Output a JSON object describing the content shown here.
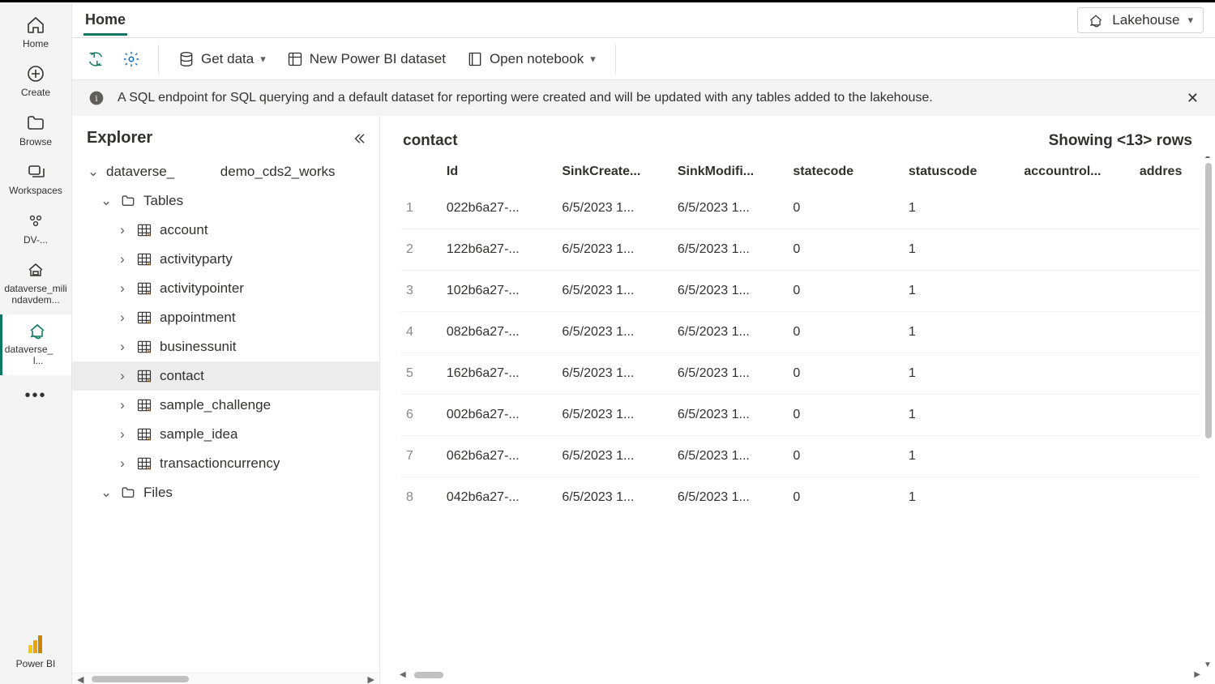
{
  "nav": {
    "items": [
      {
        "label": "Home"
      },
      {
        "label": "Create"
      },
      {
        "label": "Browse"
      },
      {
        "label": "Workspaces"
      },
      {
        "label": "DV-..."
      },
      {
        "label": "dataverse_milindavdem..."
      },
      {
        "label": "dataverse_       l..."
      }
    ],
    "powerbi_label": "Power BI"
  },
  "header": {
    "tab": "Home",
    "mode_selector": "Lakehouse"
  },
  "toolbar": {
    "get_data": "Get data",
    "new_dataset": "New Power BI dataset",
    "open_notebook": "Open notebook"
  },
  "infobar": {
    "message": "A SQL endpoint for SQL querying and a default dataset for reporting were created and will be updated with any tables added to the lakehouse."
  },
  "explorer": {
    "title": "Explorer",
    "root": "dataverse_            demo_cds2_works",
    "tables_label": "Tables",
    "files_label": "Files",
    "tables": [
      "account",
      "activityparty",
      "activitypointer",
      "appointment",
      "businessunit",
      "contact",
      "sample_challenge",
      "sample_idea",
      "transactioncurrency"
    ],
    "selected_table": "contact"
  },
  "grid": {
    "title": "contact",
    "row_count_text": "Showing <13> rows",
    "columns": [
      "Id",
      "SinkCreate...",
      "SinkModifi...",
      "statecode",
      "statuscode",
      "accountrol...",
      "addres"
    ],
    "rows": [
      {
        "n": "1",
        "Id": "022b6a27-...",
        "SinkCreate": "6/5/2023 1...",
        "SinkModifi": "6/5/2023 1...",
        "statecode": "0",
        "statuscode": "1"
      },
      {
        "n": "2",
        "Id": "122b6a27-...",
        "SinkCreate": "6/5/2023 1...",
        "SinkModifi": "6/5/2023 1...",
        "statecode": "0",
        "statuscode": "1"
      },
      {
        "n": "3",
        "Id": "102b6a27-...",
        "SinkCreate": "6/5/2023 1...",
        "SinkModifi": "6/5/2023 1...",
        "statecode": "0",
        "statuscode": "1"
      },
      {
        "n": "4",
        "Id": "082b6a27-...",
        "SinkCreate": "6/5/2023 1...",
        "SinkModifi": "6/5/2023 1...",
        "statecode": "0",
        "statuscode": "1"
      },
      {
        "n": "5",
        "Id": "162b6a27-...",
        "SinkCreate": "6/5/2023 1...",
        "SinkModifi": "6/5/2023 1...",
        "statecode": "0",
        "statuscode": "1"
      },
      {
        "n": "6",
        "Id": "002b6a27-...",
        "SinkCreate": "6/5/2023 1...",
        "SinkModifi": "6/5/2023 1...",
        "statecode": "0",
        "statuscode": "1"
      },
      {
        "n": "7",
        "Id": "062b6a27-...",
        "SinkCreate": "6/5/2023 1...",
        "SinkModifi": "6/5/2023 1...",
        "statecode": "0",
        "statuscode": "1"
      },
      {
        "n": "8",
        "Id": "042b6a27-...",
        "SinkCreate": "6/5/2023 1...",
        "SinkModifi": "6/5/2023 1...",
        "statecode": "0",
        "statuscode": "1"
      }
    ]
  }
}
